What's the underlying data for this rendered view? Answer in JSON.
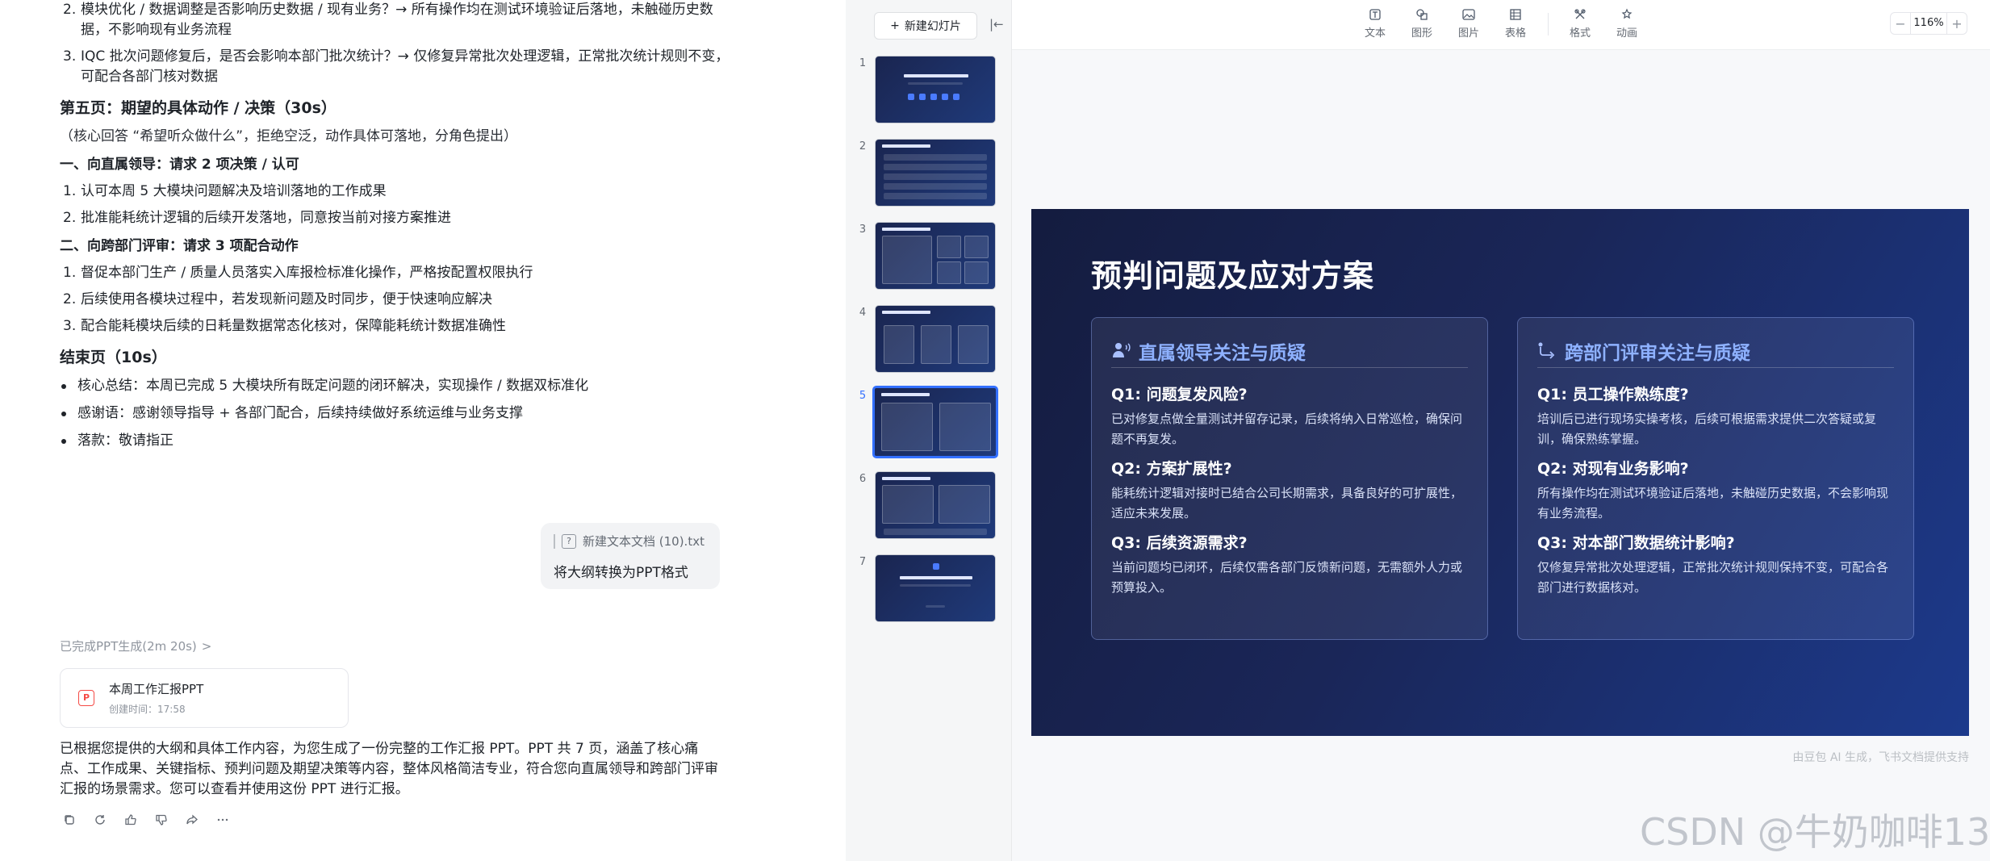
{
  "outline": {
    "top_items": [
      {
        "num": "2.",
        "text": "模块优化 / 数据调整是否影响历史数据 / 现有业务？→ 所有操作均在测试环境验证后落地，未触碰历史数据，不影响现有业务流程"
      },
      {
        "num": "3.",
        "text": "IQC 批次问题修复后，是否会影响本部门批次统计？→ 仅修复异常批次处理逻辑，正常批次统计规则不变，可配合各部门核对数据"
      }
    ],
    "page5_title": "第五页：期望的具体动作 / 决策（30s）",
    "page5_note": "（核心回答 “希望听众做什么”，拒绝空泛，动作具体可落地，分角色提出）",
    "section1_title": "一、向直属领导：请求 2 项决策 / 认可",
    "section1_items": [
      {
        "num": "1.",
        "text": "认可本周 5 大模块问题解决及培训落地的工作成果"
      },
      {
        "num": "2.",
        "text": "批准能耗统计逻辑的后续开发落地，同意按当前对接方案推进"
      }
    ],
    "section2_title": "二、向跨部门评审：请求 3 项配合动作",
    "section2_items": [
      {
        "num": "1.",
        "text": "督促本部门生产 / 质量人员落实入库报检标准化操作，严格按配置权限执行"
      },
      {
        "num": "2.",
        "text": "后续使用各模块过程中，若发现新问题及时同步，便于快速响应解决"
      },
      {
        "num": "3.",
        "text": "配合能耗模块后续的日耗量数据常态化核对，保障能耗统计数据准确性"
      }
    ],
    "end_title": "结束页（10s）",
    "end_items": [
      "核心总结：本周已完成 5 大模块所有既定问题的闭环解决，实现操作 / 数据双标准化",
      "感谢语：感谢领导指导 + 各部门配合，后续持续做好系统运维与业务支撑",
      "落款：敬请指正"
    ]
  },
  "user_message": {
    "file_name": "新建文本文档 (10).txt",
    "text": "将大纲转换为PPT格式"
  },
  "status": {
    "text": "已完成PPT生成(2m 20s)",
    "chevron": ">"
  },
  "ppt_card": {
    "icon_letter": "P",
    "title": "本周工作汇报PPT",
    "created": "创建时间：17:58"
  },
  "reply_text": "已根据您提供的大纲和具体工作内容，为您生成了一份完整的工作汇报 PPT。PPT 共 7 页，涵盖了核心痛点、工作成果、关键指标、预判问题及期望决策等内容，整体风格简洁专业，符合您向直属领导和跨部门评审汇报的场景需求。您可以查看并使用这份 PPT 进行汇报。",
  "action_icons": [
    "copy-icon",
    "refresh-icon",
    "thumbs-up-icon",
    "thumbs-down-icon",
    "share-icon",
    "more-icon"
  ],
  "thumbnails": {
    "new_slide_label": "新建幻灯片",
    "new_slide_icon": "+",
    "collapse_icon": "|←",
    "items": [
      {
        "num": "1"
      },
      {
        "num": "2"
      },
      {
        "num": "3"
      },
      {
        "num": "4"
      },
      {
        "num": "5",
        "active": true
      },
      {
        "num": "6"
      },
      {
        "num": "7"
      }
    ]
  },
  "toolbar": {
    "tools": [
      {
        "label": "文本",
        "icon": "text-icon"
      },
      {
        "label": "图形",
        "icon": "shape-icon"
      },
      {
        "label": "图片",
        "icon": "image-icon"
      },
      {
        "label": "表格",
        "icon": "table-icon"
      },
      {
        "label": "格式",
        "icon": "format-icon"
      },
      {
        "label": "动画",
        "icon": "animation-icon"
      }
    ],
    "zoom_minus": "−",
    "zoom_value": "116%",
    "zoom_plus": "+"
  },
  "slide": {
    "title": "预判问题及应对方案",
    "accent": "#8eb1ff",
    "left_panel": {
      "icon": "leader-icon",
      "title": "直属领导关注与质疑",
      "qa": [
        {
          "q": "Q1: 问题复发风险?",
          "a": "已对修复点做全量测试并留存记录，后续将纳入日常巡检，确保问题不再复发。"
        },
        {
          "q": "Q2: 方案扩展性?",
          "a": "能耗统计逻辑对接时已结合公司长期需求，具备良好的可扩展性，适应未来发展。"
        },
        {
          "q": "Q3: 后续资源需求?",
          "a": "当前问题均已闭环，后续仅需各部门反馈新问题，无需额外人力或预算投入。"
        }
      ]
    },
    "right_panel": {
      "icon": "cross-dept-icon",
      "title": "跨部门评审关注与质疑",
      "qa": [
        {
          "q": "Q1: 员工操作熟练度?",
          "a": "培训后已进行现场实操考核，后续可根据需求提供二次答疑或复训，确保熟练掌握。"
        },
        {
          "q": "Q2: 对现有业务影响?",
          "a": "所有操作均在测试环境验证后落地，未触碰历史数据，不会影响现有业务流程。"
        },
        {
          "q": "Q3: 对本部门数据统计影响?",
          "a": "仅修复异常批次处理逻辑，正常批次统计规则保持不变，可配合各部门进行数据核对。"
        }
      ]
    }
  },
  "footer_note": "由豆包 AI 生成，飞书文档提供支持",
  "watermark": "CSDN @牛奶咖啡13"
}
